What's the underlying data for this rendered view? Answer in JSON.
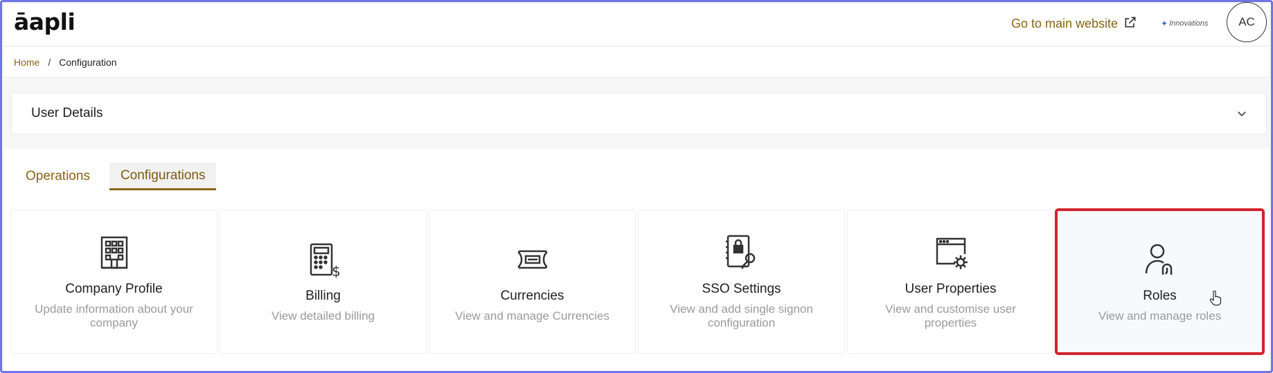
{
  "header": {
    "logo": "āapli",
    "main_link": "Go to main website",
    "innovations": "Innovations",
    "avatar_initials": "AC"
  },
  "breadcrumb": {
    "home": "Home",
    "separator": "/",
    "current": "Configuration"
  },
  "accordion": {
    "title": "User Details"
  },
  "tabs": [
    {
      "label": "Operations",
      "active": false
    },
    {
      "label": "Configurations",
      "active": true
    }
  ],
  "cards": [
    {
      "icon": "building-icon",
      "title": "Company Profile",
      "desc": "Update information about your company"
    },
    {
      "icon": "billing-calculator-icon",
      "title": "Billing",
      "desc": "View detailed billing"
    },
    {
      "icon": "currency-ticket-icon",
      "title": "Currencies",
      "desc": "View and manage Currencies"
    },
    {
      "icon": "sso-lock-key-icon",
      "title": "SSO Settings",
      "desc": "View and add single signon configuration"
    },
    {
      "icon": "user-properties-gear-icon",
      "title": "User Properties",
      "desc": "View and customise user properties"
    },
    {
      "icon": "roles-user-icon",
      "title": "Roles",
      "desc": "View and manage roles"
    }
  ],
  "colors": {
    "accent": "#8a6512",
    "highlight": "#d1242f",
    "frame": "#6f74e6"
  }
}
